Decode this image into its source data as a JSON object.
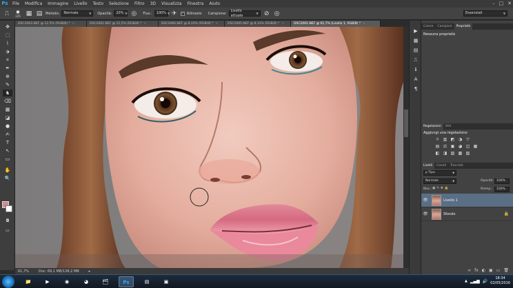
{
  "app": {
    "logo": "Ps"
  },
  "menu": [
    "File",
    "Modifica",
    "Immagine",
    "Livello",
    "Testo",
    "Selezione",
    "Filtro",
    "3D",
    "Visualizza",
    "Finestra",
    "Aiuto"
  ],
  "window_controls": [
    "–",
    "□",
    "✕"
  ],
  "options": {
    "brush_size": "125",
    "mode_label": "Metodo:",
    "mode_value": "Normale",
    "opacity_label": "Opacità:",
    "opacity_value": "20%",
    "flow_label": "Flus.:",
    "flow_value": "100%",
    "aligned_label": "Allineato",
    "sample_label": "Campione:",
    "sample_value": "Livello attuale",
    "workspace": "Essenziali"
  },
  "tabs": [
    {
      "label": "DSC2063.NEF @ 12,5% (RGB/8) *"
    },
    {
      "label": "DSC2062.NEF @ 12,5% (RGB/8) *"
    },
    {
      "label": "DSC2066.NEF @ 8,33% (RGB/8) *"
    },
    {
      "label": "DSC2065.NEF @ 8,33% (RGB/8) *"
    },
    {
      "label": "DSC2061.NEF @ 61,7% (Livello 1, RGB/8) *",
      "active": true
    }
  ],
  "tools": [
    "✥",
    "⬚",
    "⌇",
    "⬗",
    "⌗",
    "✒",
    "⊕",
    "✎",
    "♞",
    "⌫",
    "▦",
    "◪",
    "●",
    "✍",
    "T",
    "↖",
    "▭",
    "✋",
    "🔍"
  ],
  "status": {
    "zoom": "61,7%",
    "doc": "Doc: 69,1 MB/138,2 MB"
  },
  "panels": {
    "top_tabs": [
      "Colore",
      "Campioni",
      "Proprietà"
    ],
    "top_title": "Nessuna proprietà",
    "mid_tabs": [
      "Regolazioni",
      "Stili"
    ],
    "mid_title": "Aggiungi una regolazione",
    "adj_row1": [
      "☼",
      "▥",
      "◩",
      "◑",
      "▽"
    ],
    "adj_row2": [
      "▤",
      "⚖",
      "▣",
      "◕",
      "◫",
      "▦"
    ],
    "adj_row3": [
      "◧",
      "◨",
      "▨",
      "▩",
      "▧"
    ],
    "layers_tabs": [
      "Livelli",
      "Canali",
      "Tracciati"
    ],
    "kind_label": "ρ Tipo",
    "blend_mode": "Normale",
    "opacity_label": "Opacità:",
    "opacity_value": "100%",
    "lock_label": "Bloc.:",
    "fill_label": "Riemp.:",
    "fill_value": "100%",
    "layers": [
      {
        "name": "Livello 1",
        "visible": true,
        "selected": true
      },
      {
        "name": "Sfondo",
        "visible": true,
        "locked": true
      }
    ],
    "footer_icons": [
      "∞",
      "fx",
      "◐",
      "▣",
      "▭",
      "🗑"
    ]
  },
  "taskbar": {
    "apps": [
      "📁",
      "▶",
      "◉",
      "🗂",
      "Ps",
      "▤",
      "▣"
    ],
    "time": "18:34",
    "date": "02/05/2016"
  },
  "colors": {
    "foreground": "#d38a8a",
    "background": "#ffffff",
    "accent": "#31a8ff"
  }
}
